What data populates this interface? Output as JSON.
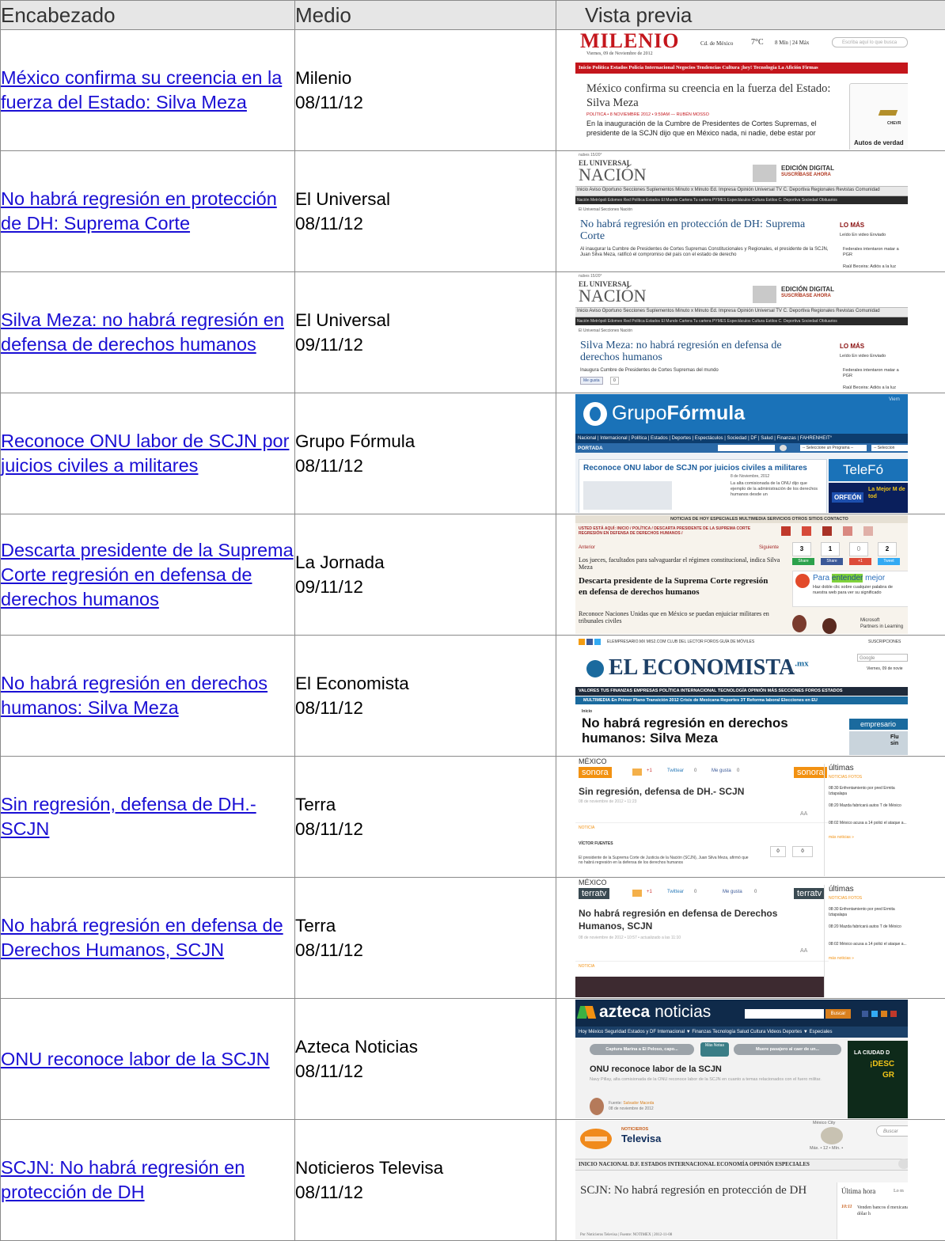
{
  "header": {
    "col_headline": "Encabezado",
    "col_medium": "Medio",
    "col_preview": "Vista previa"
  },
  "rows": [
    {
      "headline": "México confirma su creencia en la fuerza del Estado: Silva Meza",
      "medium": "Milenio",
      "date": "08/11/12",
      "preview": {
        "logo": "MILENIO",
        "dateline": "Viernes, 09 de Noviembre de 2012",
        "city": "Cd. de México",
        "temp": "7°C",
        "weather": "8 Mín | 24 Máx",
        "search_placeholder": "Escriba aquí lo que busca",
        "nav": "Inicio  Política  Estados  Policía  Internacional  Negocios  Tendencias  Cultura  ¡hey!  Tecnología  La Afición  Firmas",
        "title": "México confirma su creencia en la fuerza del Estado: Silva Meza",
        "kicker": "POLÍTICA • 8 NOVIEMBRE 2012 • 9:59AM — RUBÉN MOSSO",
        "body": "En la inauguración de la Cumbre de Presidentes de Cortes Supremas, el presidente de la SCJN dijo que en México nada, ni nadie, debe estar por",
        "ad_brand": "CHEVR",
        "ad_text": "Autos de verdad"
      }
    },
    {
      "headline": "No habrá regresión en protección de DH: Suprema Corte",
      "medium": "El Universal",
      "date": "08/11/12",
      "preview": {
        "weather": "nubes 15/20°",
        "logo_top": "EL UNIVERSAL",
        "logo": "NACIÓN",
        "edition": "EDICIÓN DIGITAL",
        "subscribe": "SUSCRÍBASE AHORA",
        "nav": "Inicio  Aviso Oportuno  Secciones  Suplementos  Minuto x Minuto  Ed. Impresa  Opinión  Universal TV  C. Deportiva  Regionales  Revistas  Comunidad",
        "subnav": "Nación  Metrópoli  Edomex  Red Política  Estados  El Mundo  Cartera  Tu cartera  PYMES  Espectáculos  Cultura  Estilos  C. Deportiva  Sociedad  Obituarios",
        "crumb": "El Universal  Secciones  Nación",
        "title": "No habrá regresión en protección de DH: Suprema Corte",
        "body": "Al inaugurar la Cumbre de Presidentes de Cortes Supremas Constitucionales y Regionales, el presidente de la SCJN, Juan Silva Meza, ratificó el compromiso del país con el estado de derecho",
        "side_title": "LO MÁS",
        "side_tabs": "Leído   En video   Enviado",
        "side_item1": "Federales intentaron matar a PGR",
        "side_item2": "Raúl Beceira: Adiós a la luz"
      }
    },
    {
      "headline": "Silva Meza: no habrá regresión en defensa de derechos humanos",
      "medium": "El Universal",
      "date": "09/11/12",
      "preview": {
        "weather": "nubes 15/20°",
        "logo_top": "EL UNIVERSAL",
        "logo": "NACIÓN",
        "edition": "EDICIÓN DIGITAL",
        "subscribe": "SUSCRÍBASE AHORA",
        "nav": "Inicio  Aviso Oportuno  Secciones  Suplementos  Minuto x Minuto  Ed. Impresa  Opinión  Universal TV  C. Deportiva  Regionales  Revistas  Comunidad",
        "subnav": "Nación  Metrópoli  Edomex  Red Política  Estados  El Mundo  Cartera  Tu cartera  PYMES  Espectáculos  Cultura  Estilos  C. Deportiva  Sociedad  Obituarios",
        "crumb": "El Universal  Secciones  Nación",
        "title": "Silva Meza: no habrá regresión en defensa de derechos humanos",
        "body": "Inaugura Cumbre de Presidentes de Cortes Supremas del mundo",
        "like": "Me gusta",
        "like_count": "0",
        "side_title": "LO MÁS",
        "side_tabs": "Leído   En video   Enviado",
        "side_item1": "Federales intentaron matar a PGR",
        "side_item2": "Raúl Beceira: Adiós a la luz"
      }
    },
    {
      "headline": "Reconoce ONU labor de SCJN por juicios civiles a militares",
      "medium": "Grupo Fórmula",
      "date": "08/11/12",
      "preview": {
        "logo_a": "Grupo",
        "logo_b": "Fórmula",
        "corner": "Viern",
        "nav": "Nacional | Internacional | Política | Estados | Deportes | Espectáculos | Sociedad | DF | Salud | Finanzas | FAHRENHEIT°",
        "section": "PORTADA",
        "select1": "-- Seleccione un Programa --",
        "select2": "-- Seleccion",
        "title": "Reconoce ONU labor de SCJN por juicios civiles a militares",
        "date": "8 de Noviembre, 2012",
        "body": "La alta comisionada de la ONU dijo que ejemplo de la administración de los derechos humanos desde un",
        "side_logo": "TeleFó",
        "side_brand": "ORFEÓN",
        "side_text": "La Mejor M de tod"
      }
    },
    {
      "headline": "Descarta presidente de la Suprema Corte regresión en defensa de derechos humanos",
      "medium": "La Jornada",
      "date": "09/11/12",
      "preview": {
        "topnav": "NOTICIAS DE HOY   ESPECIALES   MULTIMEDIA   SERVICIOS   OTROS SITIOS   CONTACTO",
        "crumb": "USTED ESTÁ AQUÍ: INICIO / POLÍTICA / DESCARTA PRESIDENTE DE LA SUPREMA CORTE REGRESIÓN EN DEFENSA DE DERECHOS HUMANOS /",
        "prev": "Anterior",
        "next": "Siguiente",
        "bullet1": "Los jueces, facultados para salvaguardar el régimen constitucional, indica Silva Meza",
        "title": "Descarta presidente de la Suprema Corte regresión en defensa de derechos humanos",
        "bullet2": "Reconoce Naciones Unidas que en México se puedan enjuiciar militares en tribunales civiles",
        "count1": "3",
        "count2": "1",
        "count3": "0",
        "count4": "2",
        "share1": "Share",
        "share2": "Share",
        "share3": "+1",
        "share4": "Tweet",
        "ad_a": "Para ",
        "ad_b": "entender",
        "ad_c": " mejor",
        "ad_body": "Haz doble clic sobre cualquier palabra de nuestra web para ver su significado",
        "ms_a": "Microsoft",
        "ms_b": "Partners in Learning"
      }
    },
    {
      "headline": "No habrá regresión en derechos humanos: Silva Meza",
      "medium": "El Economista",
      "date": "08/11/12",
      "preview": {
        "toplinks": "ELEMPRESARIO.MX   MIS2.COM   CLUB DEL LECTOR   FOROS   GUÍA DE MÓVILES",
        "subscriptions": "SUSCRIPCIONES",
        "logo": "EL ECONOMISTA",
        "logo_sup": ".mx",
        "google": "Google",
        "date": "Viernes, 09 de novie",
        "nav": "VALORES   TUS FINANZAS   EMPRESAS   POLÍTICA   INTERNACIONAL   TECNOLOGÍA   OPINIÓN   MÁS SECCIONES   FOROS   ESTADOS",
        "subnav": "MULTIMEDIA   En Primer Plano   Transición 2012   Crisis de Mexicana   Reportes 3T   Reforma laboral   Elecciones en EU",
        "crumb": "Inicio",
        "title": "No habrá regresión en derechos humanos: Silva Meza",
        "side": "empresario",
        "side_b": "Flu sin"
      }
    },
    {
      "headline": "Sin regresión, defensa de DH.- SCJN",
      "medium": "Terra",
      "date": "08/11/12",
      "preview": {
        "section": "MÉXICO",
        "brand": "sonora",
        "brand_right": "sonora",
        "twitter": "Twittear",
        "tw_count": "0",
        "like": "Me gusta",
        "like_count": "0",
        "gplus": "+1",
        "title": "Sin regresión, defensa de DH.- SCJN",
        "date": "08 de noviembre de 2012 • 11:23",
        "aa": "AA",
        "tag": "NOTICIA",
        "author": "VÍCTOR FUENTES",
        "body": "El presidente de la Suprema Corte de Justicia de la Nación (SCJN), Juan Silva Meza, afirmó que no habrá regresión en la defensa de los derechos humanos",
        "box1": "0",
        "box2": "0",
        "side_title": "últimas",
        "side_tabs": "NOTICIAS   FOTOS",
        "side1": "08:30 Enfrentamiento por pred Ermita Iztapalapa",
        "side2": "08:20 Mazda fabricará autos T de México",
        "side3": "08:02 México acusa a 14 polici el ataque a...",
        "side_more": "más noticias »"
      }
    },
    {
      "headline": "No habrá regresión en defensa de Derechos Humanos, SCJN",
      "medium": "Terra",
      "date": "08/11/12",
      "preview": {
        "section": "MÉXICO",
        "brand": "terratv",
        "brand_right": "terratv",
        "twitter": "Twittear",
        "tw_count": "0",
        "like": "Me gusta",
        "like_count": "0",
        "gplus": "+1",
        "title": "No habrá regresión en defensa de Derechos Humanos, SCJN",
        "date": "08 de noviembre de 2012 • 10:57 • actualizado a las 11:10",
        "aa": "AA",
        "tag": "NOTICIA",
        "side_title": "últimas",
        "side_tabs": "NOTICIAS   FOTOS",
        "side1": "08:30 Enfrentamiento por pred Ermita Iztapalapa",
        "side2": "08:20 Mazda fabricará autos T de México",
        "side3": "08:02 México acusa a 14 polici el ataque a...",
        "side_more": "más noticias »"
      }
    },
    {
      "headline": "ONU reconoce labor de la SCJN",
      "medium": "Azteca Noticias",
      "date": "08/11/12",
      "preview": {
        "logo_a": "azteca",
        "logo_b": "noticias",
        "search_button": "Buscar",
        "nav": "Hoy   México   Seguridad   Estados y DF   Internacional   ▼ Finanzas   Tecnología   Salud   Cultura   Videos   Deportes   ▼ Especiales",
        "pill1": "Captura Marina a El Peloso, capo...",
        "pill_mid": "Más Notas",
        "pill2": "Muere pasajero al caer de un...",
        "title": "ONU reconoce labor de la SCJN",
        "body": "Navy Pillay, alta comisionada de la ONU reconoce labor de la SCJN en cuanto a temas relacionados con el fuero militar.",
        "source_label": "Fuente: ",
        "source_name": "Salvador Maceda",
        "date": "08 de noviembre de 2012",
        "ad1": "LA CIUDAD D",
        "ad2": "¡DESC",
        "ad3": "GR"
      }
    },
    {
      "headline": "SCJN: No habrá regresión en protección de DH",
      "medium": "Noticieros Televisa",
      "date": "08/11/12",
      "preview": {
        "logo_a": "NOTICIEROS",
        "logo_b": "Televisa",
        "city": "México City",
        "temps": "Máx. • 12 • Mín. •",
        "search": "Buscar",
        "nav": "INICIO   NACIONAL   D.F.   ESTADOS   INTERNACIONAL   ECONOMÍA   OPINIÓN   ESPECIALES",
        "title": "SCJN: No habrá regresión en protección de DH",
        "byline": "Por Noticieros Televisa | Fuente: NOTIMEX | 2012-11-08",
        "side_title": "Última hora",
        "side_more": "Lo m",
        "side_time": "10:11",
        "side_text": "Venden bancos d mexicana dólar h"
      }
    }
  ]
}
